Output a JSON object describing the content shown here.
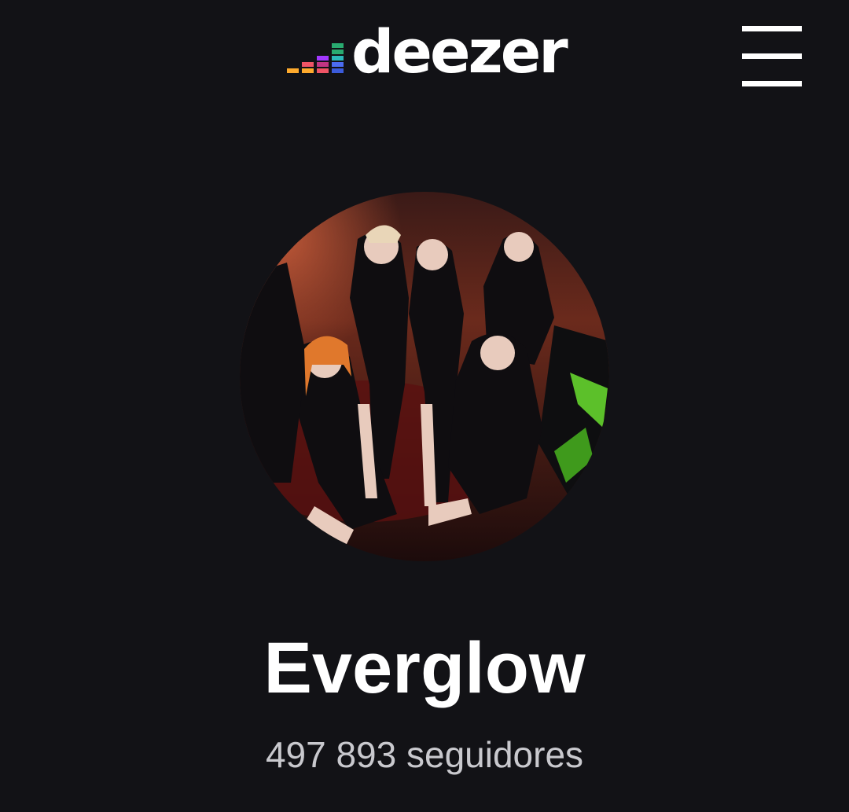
{
  "header": {
    "logo_text": "deezer",
    "logo_icon": "equalizer-bars-icon",
    "menu_icon": "hamburger-menu-icon",
    "logo_colors": [
      "#feaa2d",
      "#ef5466",
      "#c13584",
      "#a238ff",
      "#2cb9b9",
      "#29ab70"
    ]
  },
  "artist": {
    "name": "Everglow",
    "followers": "497 893 seguidores",
    "picture": "artist-photo"
  }
}
